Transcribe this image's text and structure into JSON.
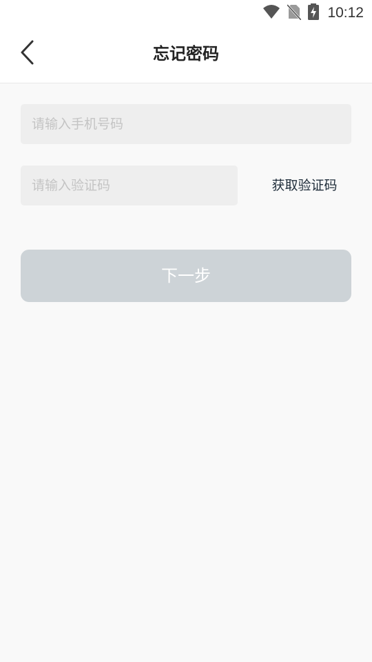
{
  "status_bar": {
    "time": "10:12",
    "icons": [
      "wifi-icon",
      "no-sim-icon",
      "battery-charging-icon"
    ]
  },
  "app_bar": {
    "title": "忘记密码",
    "back_icon": "chevron-left-icon"
  },
  "form": {
    "phone": {
      "placeholder": "请输入手机号码",
      "value": ""
    },
    "code": {
      "placeholder": "请输入验证码",
      "value": ""
    },
    "get_code_label": "获取验证码",
    "next_label": "下一步"
  },
  "colors": {
    "background": "#f9f9f9",
    "field_background": "#eeeeee",
    "button_disabled": "#cdd3d7",
    "link_text": "#1f2d3a"
  }
}
